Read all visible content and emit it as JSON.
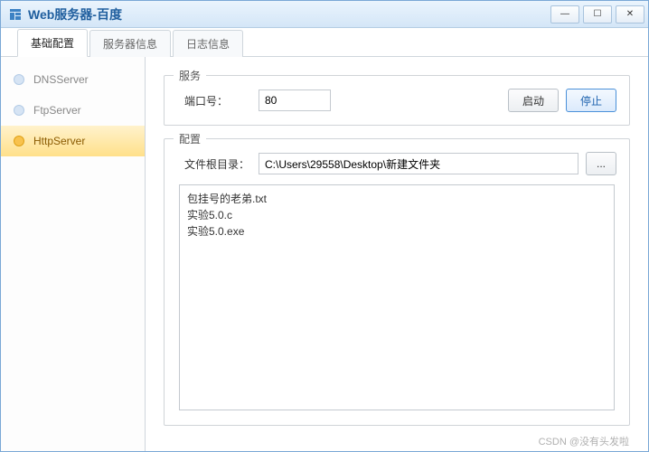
{
  "window": {
    "title": "Web服务器-百度"
  },
  "tabs": [
    {
      "label": "基础配置"
    },
    {
      "label": "服务器信息"
    },
    {
      "label": "日志信息"
    }
  ],
  "sidebar": {
    "items": [
      {
        "label": "DNSServer"
      },
      {
        "label": "FtpServer"
      },
      {
        "label": "HttpServer"
      }
    ]
  },
  "service": {
    "legend": "服务",
    "port_label": "端口号：",
    "port_value": "80",
    "start_label": "启动",
    "stop_label": "停止"
  },
  "config": {
    "legend": "配置",
    "root_label": "文件根目录：",
    "root_value": "C:\\Users\\29558\\Desktop\\新建文件夹",
    "browse_label": "...",
    "files": [
      "包挂号的老弟.txt",
      "实验5.0.c",
      "实验5.0.exe"
    ]
  },
  "watermark": "CSDN @没有头发啦"
}
